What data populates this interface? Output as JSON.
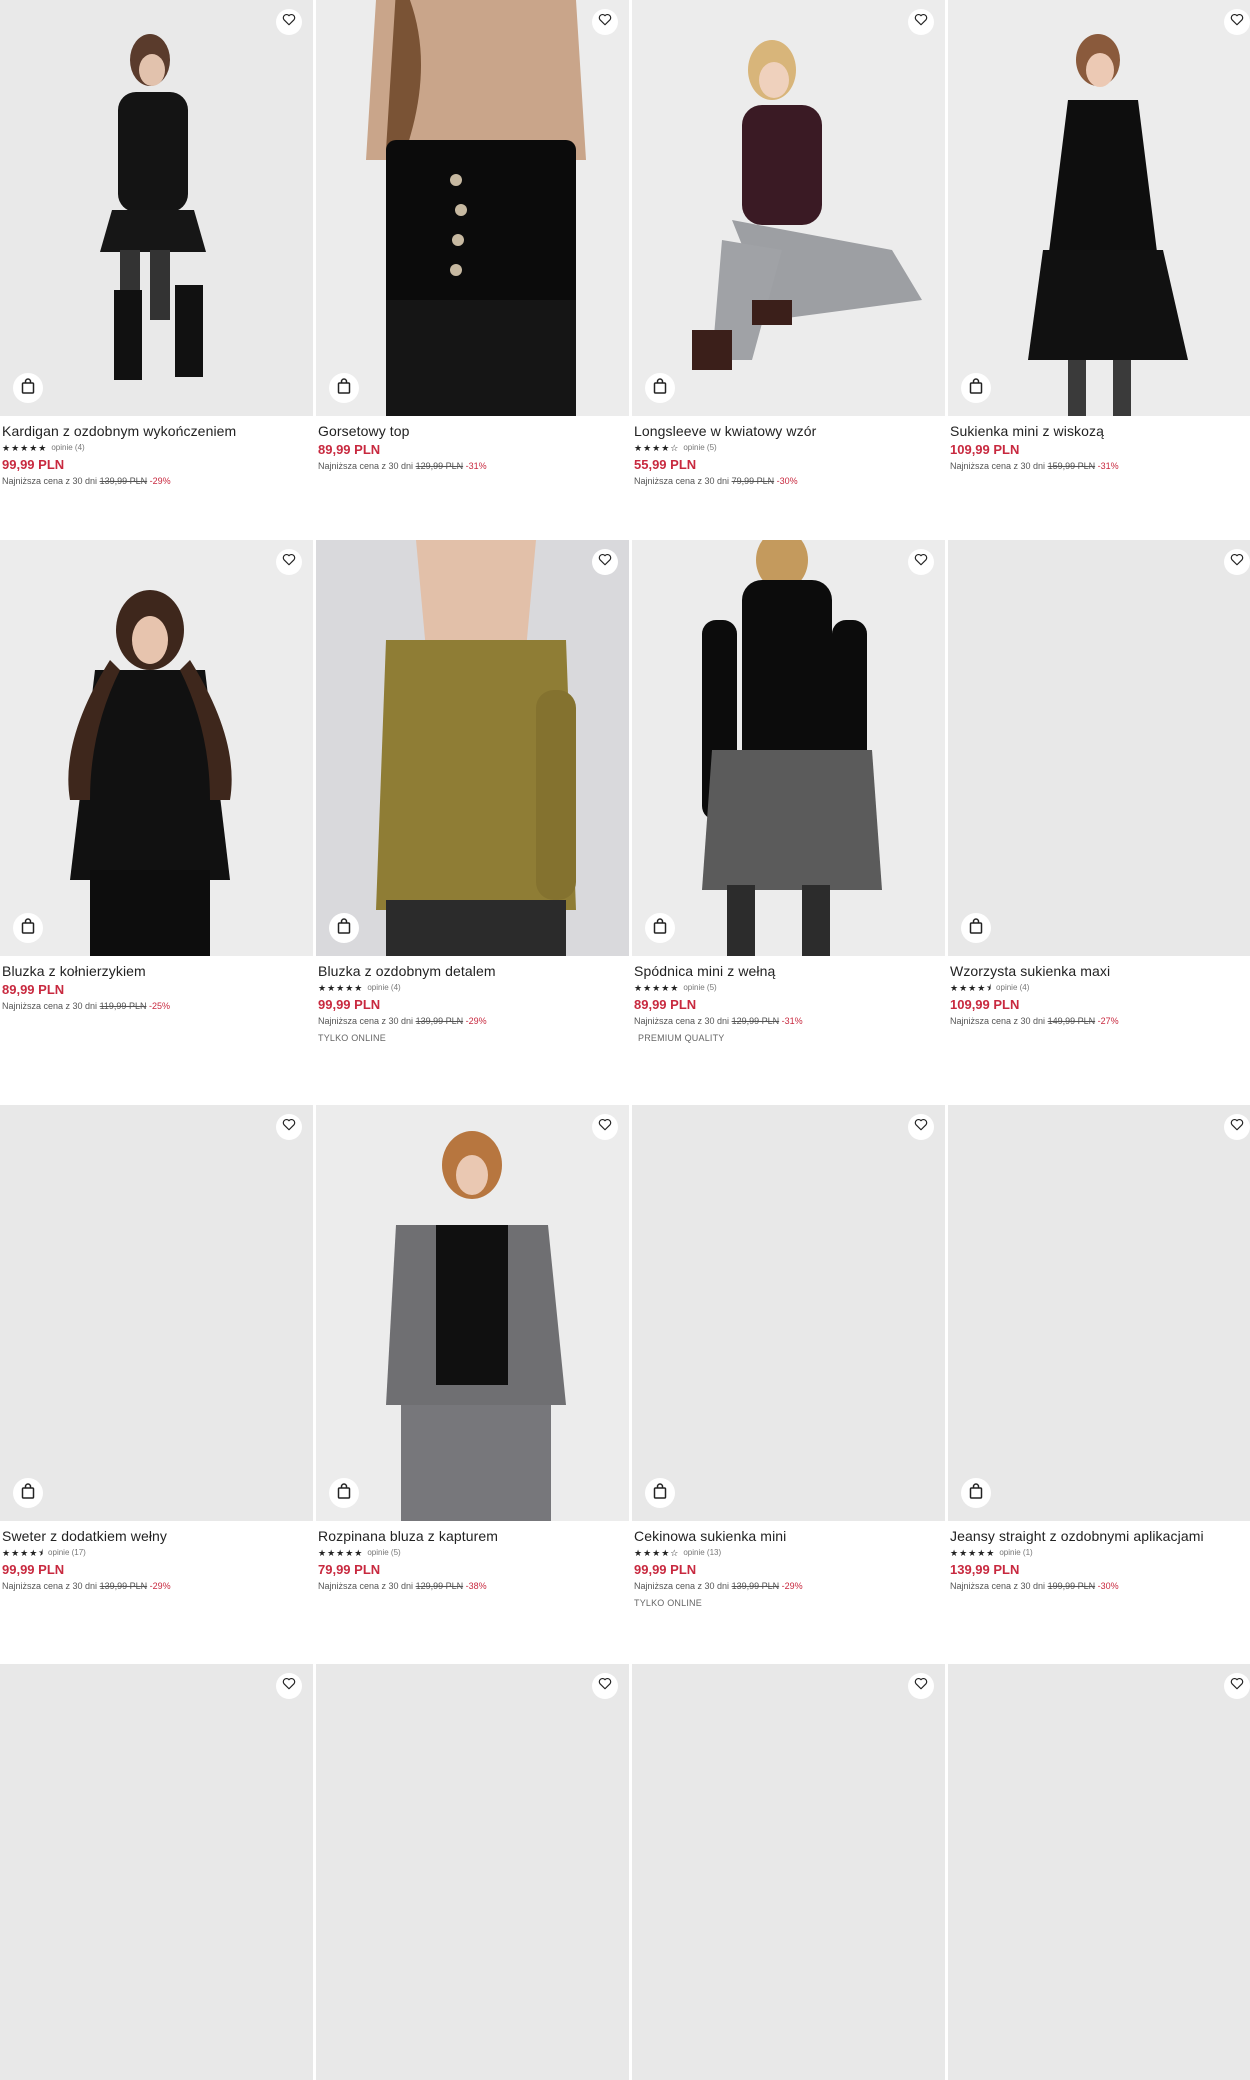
{
  "icons": {
    "favorite": "heart-icon",
    "add_to_bag": "bag-icon"
  },
  "colors": {
    "price": "#c8293f",
    "discount": "#c8293f",
    "image_placeholder": "#e8e8e8"
  },
  "products": [
    {
      "name": "Kardigan z ozdobnym wykończeniem",
      "stars": "★★★★★",
      "reviews": "opinie (4)",
      "price": "99,99 PLN",
      "lowest_label": "Najniższa cena z 30 dni",
      "old_price": "139,99 PLN",
      "discount": "-29%",
      "tag": ""
    },
    {
      "name": "Gorsetowy top",
      "stars": "",
      "reviews": "",
      "price": "89,99 PLN",
      "lowest_label": "Najniższa cena z 30 dni",
      "old_price": "129,99 PLN",
      "discount": "-31%",
      "tag": ""
    },
    {
      "name": "Longsleeve w kwiatowy wzór",
      "stars": "★★★★☆",
      "reviews": "opinie (5)",
      "price": "55,99 PLN",
      "lowest_label": "Najniższa cena z 30 dni",
      "old_price": "79,99 PLN",
      "discount": "-30%",
      "tag": ""
    },
    {
      "name": "Sukienka mini z wiskozą",
      "stars": "",
      "reviews": "",
      "price": "109,99 PLN",
      "lowest_label": "Najniższa cena z 30 dni",
      "old_price": "159,99 PLN",
      "discount": "-31%",
      "tag": ""
    },
    {
      "name": "Bluzka z kołnierzykiem",
      "stars": "",
      "reviews": "",
      "price": "89,99 PLN",
      "lowest_label": "Najniższa cena z 30 dni",
      "old_price": "119,99 PLN",
      "discount": "-25%",
      "tag": ""
    },
    {
      "name": "Bluzka z ozdobnym detalem",
      "stars": "★★★★★",
      "reviews": "opinie (4)",
      "price": "99,99 PLN",
      "lowest_label": "Najniższa cena z 30 dni",
      "old_price": "139,99 PLN",
      "discount": "-29%",
      "tag": "TYLKO ONLINE"
    },
    {
      "name": "Spódnica mini z wełną",
      "stars": "★★★★★",
      "reviews": "opinie (5)",
      "price": "89,99 PLN",
      "lowest_label": "Najniższa cena z 30 dni",
      "old_price": "129,99 PLN",
      "discount": "-31%",
      "tag": "PREMIUM QUALITY"
    },
    {
      "name": "Wzorzysta sukienka maxi",
      "stars": "★★★★⯨",
      "reviews": "opinie (4)",
      "price": "109,99 PLN",
      "lowest_label": "Najniższa cena z 30 dni",
      "old_price": "149,99 PLN",
      "discount": "-27%",
      "tag": ""
    },
    {
      "name": "Sweter z dodatkiem wełny",
      "stars": "★★★★⯨",
      "reviews": "opinie (17)",
      "price": "99,99 PLN",
      "lowest_label": "Najniższa cena z 30 dni",
      "old_price": "139,99 PLN",
      "discount": "-29%",
      "tag": ""
    },
    {
      "name": "Rozpinana bluza z kapturem",
      "stars": "★★★★★",
      "reviews": "opinie (5)",
      "price": "79,99 PLN",
      "lowest_label": "Najniższa cena z 30 dni",
      "old_price": "129,99 PLN",
      "discount": "-38%",
      "tag": ""
    },
    {
      "name": "Cekinowa sukienka mini",
      "stars": "★★★★☆",
      "reviews": "opinie (13)",
      "price": "99,99 PLN",
      "lowest_label": "Najniższa cena z 30 dni",
      "old_price": "139,99 PLN",
      "discount": "-29%",
      "tag": "TYLKO ONLINE"
    },
    {
      "name": "Jeansy straight z ozdobnymi aplikacjami",
      "stars": "★★★★★",
      "reviews": "opinie (1)",
      "price": "139,99 PLN",
      "lowest_label": "Najniższa cena z 30 dni",
      "old_price": "199,99 PLN",
      "discount": "-30%",
      "tag": ""
    },
    {
      "name": "",
      "stars": "",
      "reviews": "",
      "price": "",
      "lowest_label": "",
      "old_price": "",
      "discount": "",
      "tag": ""
    },
    {
      "name": "",
      "stars": "",
      "reviews": "",
      "price": "",
      "lowest_label": "",
      "old_price": "",
      "discount": "",
      "tag": ""
    },
    {
      "name": "",
      "stars": "",
      "reviews": "",
      "price": "",
      "lowest_label": "",
      "old_price": "",
      "discount": "",
      "tag": ""
    },
    {
      "name": "",
      "stars": "",
      "reviews": "",
      "price": "",
      "lowest_label": "",
      "old_price": "",
      "discount": "",
      "tag": ""
    }
  ]
}
